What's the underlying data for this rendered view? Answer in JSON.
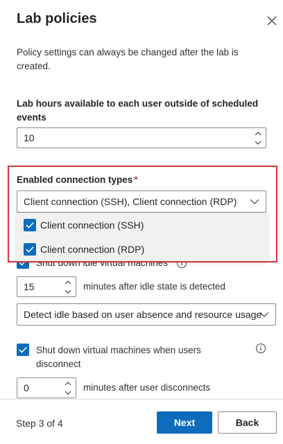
{
  "panel": {
    "title": "Lab policies",
    "description": "Policy settings can always be changed after the lab is created."
  },
  "hours": {
    "label": "Lab hours available to each user outside of scheduled events",
    "value": "10"
  },
  "connection": {
    "label": "Enabled connection types",
    "required_marker": "*",
    "selected_text": "Client connection (SSH), Client connection (RDP)",
    "options": [
      {
        "label": "Client connection (SSH)",
        "checked": true
      },
      {
        "label": "Client connection (RDP)",
        "checked": true
      }
    ]
  },
  "idle": {
    "label": "Shut down idle virtual machines",
    "checked": true,
    "minutes": "15",
    "minutes_suffix": "minutes after idle state is detected",
    "detect_mode": "Detect idle based on user absence and resource usage"
  },
  "disconnect": {
    "label": "Shut down virtual machines when users disconnect",
    "checked": true,
    "minutes": "0",
    "minutes_suffix": "minutes after user disconnects"
  },
  "footer": {
    "step_text": "Step 3 of 4",
    "next_label": "Next",
    "back_label": "Back"
  },
  "colors": {
    "accent": "#0f6cbd",
    "highlight_border": "#d13438",
    "required": "#c4314b"
  }
}
